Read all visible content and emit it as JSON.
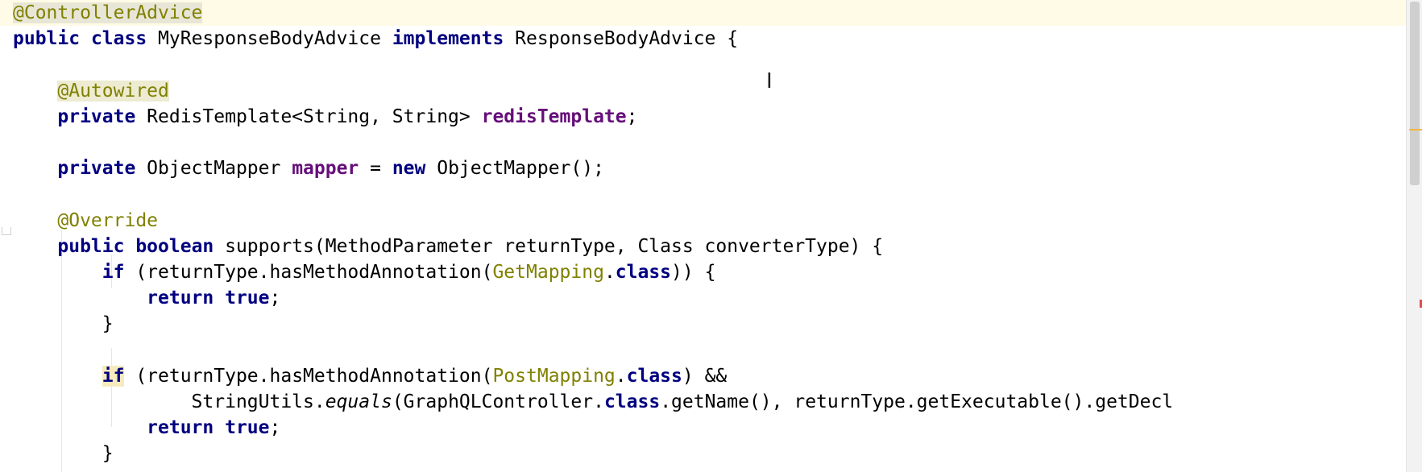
{
  "editor": {
    "lines": [
      {
        "segments": [
          {
            "t": "@ControllerAdvice",
            "c": "ann-caret"
          }
        ]
      },
      {
        "segments": [
          {
            "t": "public ",
            "c": "kw"
          },
          {
            "t": "class ",
            "c": "kw"
          },
          {
            "t": "MyResponseBodyAdvice "
          },
          {
            "t": "implements ",
            "c": "kw"
          },
          {
            "t": "ResponseBodyAdvice {"
          }
        ]
      },
      {
        "segments": []
      },
      {
        "segments": [
          {
            "t": "    "
          },
          {
            "t": "@Autowired",
            "c": "ann-hl"
          }
        ]
      },
      {
        "segments": [
          {
            "t": "    "
          },
          {
            "t": "private ",
            "c": "kw"
          },
          {
            "t": "RedisTemplate<String, String> "
          },
          {
            "t": "redisTemplate",
            "c": "field"
          },
          {
            "t": ";"
          }
        ]
      },
      {
        "segments": []
      },
      {
        "segments": [
          {
            "t": "    "
          },
          {
            "t": "private ",
            "c": "kw"
          },
          {
            "t": "ObjectMapper "
          },
          {
            "t": "mapper",
            "c": "field"
          },
          {
            "t": " = "
          },
          {
            "t": "new ",
            "c": "kw"
          },
          {
            "t": "ObjectMapper();"
          }
        ]
      },
      {
        "segments": []
      },
      {
        "segments": [
          {
            "t": "    "
          },
          {
            "t": "@Override",
            "c": "ann"
          }
        ]
      },
      {
        "segments": [
          {
            "t": "    "
          },
          {
            "t": "public ",
            "c": "kw"
          },
          {
            "t": "boolean ",
            "c": "kw"
          },
          {
            "t": "supports(MethodParameter returnType, Class converterType) {"
          }
        ]
      },
      {
        "segments": [
          {
            "t": "        "
          },
          {
            "t": "if",
            "c": "kw"
          },
          {
            "t": " (returnType.hasMethodAnnotation("
          },
          {
            "t": "GetMapping",
            "c": "ann"
          },
          {
            "t": "."
          },
          {
            "t": "class",
            "c": "kw"
          },
          {
            "t": ")) {"
          }
        ]
      },
      {
        "segments": [
          {
            "t": "            "
          },
          {
            "t": "return ",
            "c": "kw"
          },
          {
            "t": "true",
            "c": "kw"
          },
          {
            "t": ";"
          }
        ]
      },
      {
        "segments": [
          {
            "t": "        }"
          }
        ]
      },
      {
        "segments": []
      },
      {
        "segments": [
          {
            "t": "        "
          },
          {
            "t": "if",
            "c": "kw-hl"
          },
          {
            "t": " (returnType.hasMethodAnnotation("
          },
          {
            "t": "PostMapping",
            "c": "ann"
          },
          {
            "t": "."
          },
          {
            "t": "class",
            "c": "kw"
          },
          {
            "t": ") &&"
          }
        ]
      },
      {
        "segments": [
          {
            "t": "                StringUtils."
          },
          {
            "t": "equals",
            "c": "italic"
          },
          {
            "t": "(GraphQLController."
          },
          {
            "t": "class",
            "c": "kw"
          },
          {
            "t": ".getName(), returnType.getExecutable().getDecl"
          }
        ]
      },
      {
        "segments": [
          {
            "t": "            "
          },
          {
            "t": "return ",
            "c": "kw"
          },
          {
            "t": "true",
            "c": "kw"
          },
          {
            "t": ";"
          }
        ]
      },
      {
        "segments": [
          {
            "t": "        }"
          }
        ]
      }
    ]
  },
  "colors": {
    "keyword": "#000080",
    "annotation": "#808000",
    "field": "#660e7a",
    "caret_line": "#fffbe6"
  },
  "icons": {
    "cursor": "i-beam-cursor"
  }
}
